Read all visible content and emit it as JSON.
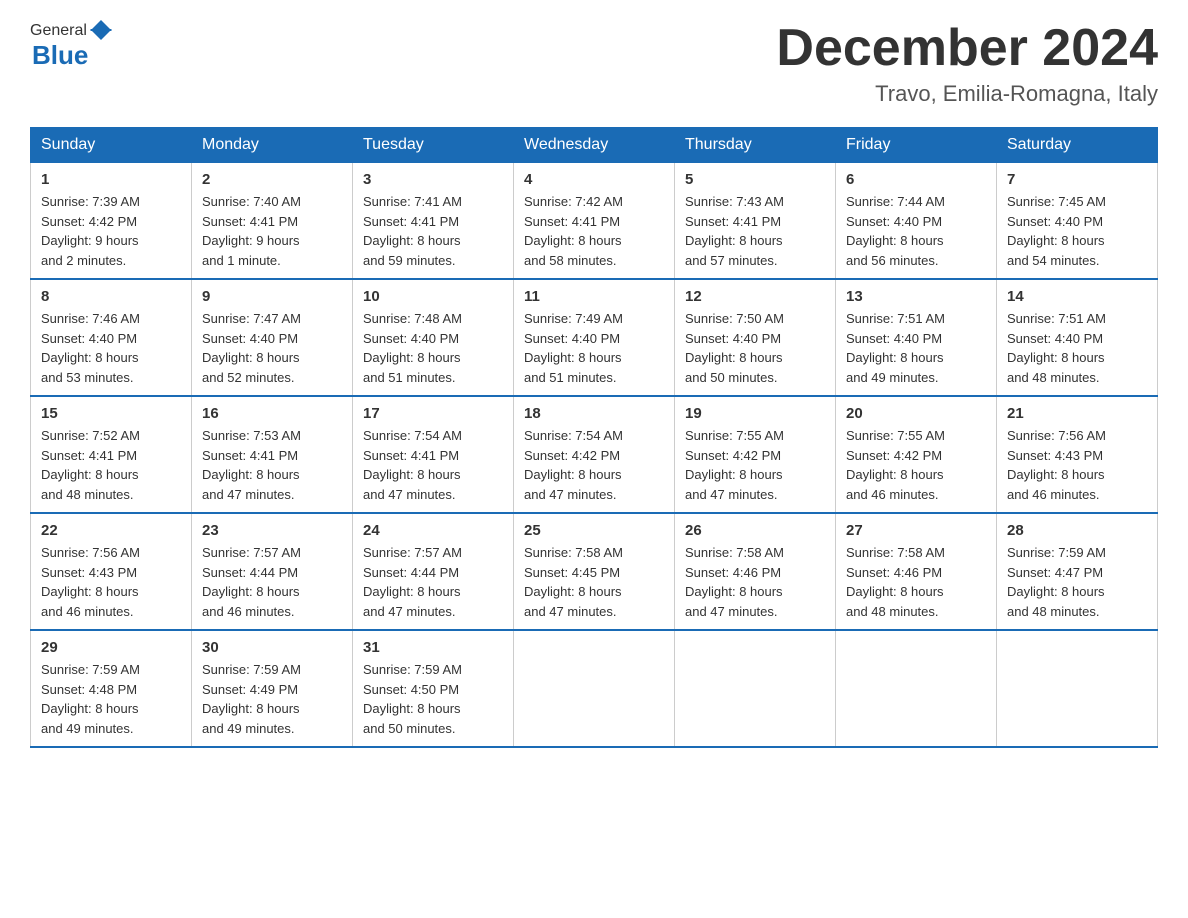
{
  "logo": {
    "general": "General",
    "blue": "Blue"
  },
  "title": "December 2024",
  "location": "Travo, Emilia-Romagna, Italy",
  "weekdays": [
    "Sunday",
    "Monday",
    "Tuesday",
    "Wednesday",
    "Thursday",
    "Friday",
    "Saturday"
  ],
  "weeks": [
    [
      {
        "day": "1",
        "sunrise": "7:39 AM",
        "sunset": "4:42 PM",
        "daylight": "9 hours and 2 minutes."
      },
      {
        "day": "2",
        "sunrise": "7:40 AM",
        "sunset": "4:41 PM",
        "daylight": "9 hours and 1 minute."
      },
      {
        "day": "3",
        "sunrise": "7:41 AM",
        "sunset": "4:41 PM",
        "daylight": "8 hours and 59 minutes."
      },
      {
        "day": "4",
        "sunrise": "7:42 AM",
        "sunset": "4:41 PM",
        "daylight": "8 hours and 58 minutes."
      },
      {
        "day": "5",
        "sunrise": "7:43 AM",
        "sunset": "4:41 PM",
        "daylight": "8 hours and 57 minutes."
      },
      {
        "day": "6",
        "sunrise": "7:44 AM",
        "sunset": "4:40 PM",
        "daylight": "8 hours and 56 minutes."
      },
      {
        "day": "7",
        "sunrise": "7:45 AM",
        "sunset": "4:40 PM",
        "daylight": "8 hours and 54 minutes."
      }
    ],
    [
      {
        "day": "8",
        "sunrise": "7:46 AM",
        "sunset": "4:40 PM",
        "daylight": "8 hours and 53 minutes."
      },
      {
        "day": "9",
        "sunrise": "7:47 AM",
        "sunset": "4:40 PM",
        "daylight": "8 hours and 52 minutes."
      },
      {
        "day": "10",
        "sunrise": "7:48 AM",
        "sunset": "4:40 PM",
        "daylight": "8 hours and 51 minutes."
      },
      {
        "day": "11",
        "sunrise": "7:49 AM",
        "sunset": "4:40 PM",
        "daylight": "8 hours and 51 minutes."
      },
      {
        "day": "12",
        "sunrise": "7:50 AM",
        "sunset": "4:40 PM",
        "daylight": "8 hours and 50 minutes."
      },
      {
        "day": "13",
        "sunrise": "7:51 AM",
        "sunset": "4:40 PM",
        "daylight": "8 hours and 49 minutes."
      },
      {
        "day": "14",
        "sunrise": "7:51 AM",
        "sunset": "4:40 PM",
        "daylight": "8 hours and 48 minutes."
      }
    ],
    [
      {
        "day": "15",
        "sunrise": "7:52 AM",
        "sunset": "4:41 PM",
        "daylight": "8 hours and 48 minutes."
      },
      {
        "day": "16",
        "sunrise": "7:53 AM",
        "sunset": "4:41 PM",
        "daylight": "8 hours and 47 minutes."
      },
      {
        "day": "17",
        "sunrise": "7:54 AM",
        "sunset": "4:41 PM",
        "daylight": "8 hours and 47 minutes."
      },
      {
        "day": "18",
        "sunrise": "7:54 AM",
        "sunset": "4:42 PM",
        "daylight": "8 hours and 47 minutes."
      },
      {
        "day": "19",
        "sunrise": "7:55 AM",
        "sunset": "4:42 PM",
        "daylight": "8 hours and 47 minutes."
      },
      {
        "day": "20",
        "sunrise": "7:55 AM",
        "sunset": "4:42 PM",
        "daylight": "8 hours and 46 minutes."
      },
      {
        "day": "21",
        "sunrise": "7:56 AM",
        "sunset": "4:43 PM",
        "daylight": "8 hours and 46 minutes."
      }
    ],
    [
      {
        "day": "22",
        "sunrise": "7:56 AM",
        "sunset": "4:43 PM",
        "daylight": "8 hours and 46 minutes."
      },
      {
        "day": "23",
        "sunrise": "7:57 AM",
        "sunset": "4:44 PM",
        "daylight": "8 hours and 46 minutes."
      },
      {
        "day": "24",
        "sunrise": "7:57 AM",
        "sunset": "4:44 PM",
        "daylight": "8 hours and 47 minutes."
      },
      {
        "day": "25",
        "sunrise": "7:58 AM",
        "sunset": "4:45 PM",
        "daylight": "8 hours and 47 minutes."
      },
      {
        "day": "26",
        "sunrise": "7:58 AM",
        "sunset": "4:46 PM",
        "daylight": "8 hours and 47 minutes."
      },
      {
        "day": "27",
        "sunrise": "7:58 AM",
        "sunset": "4:46 PM",
        "daylight": "8 hours and 48 minutes."
      },
      {
        "day": "28",
        "sunrise": "7:59 AM",
        "sunset": "4:47 PM",
        "daylight": "8 hours and 48 minutes."
      }
    ],
    [
      {
        "day": "29",
        "sunrise": "7:59 AM",
        "sunset": "4:48 PM",
        "daylight": "8 hours and 49 minutes."
      },
      {
        "day": "30",
        "sunrise": "7:59 AM",
        "sunset": "4:49 PM",
        "daylight": "8 hours and 49 minutes."
      },
      {
        "day": "31",
        "sunrise": "7:59 AM",
        "sunset": "4:50 PM",
        "daylight": "8 hours and 50 minutes."
      },
      null,
      null,
      null,
      null
    ]
  ],
  "labels": {
    "sunrise": "Sunrise:",
    "sunset": "Sunset:",
    "daylight": "Daylight:"
  }
}
